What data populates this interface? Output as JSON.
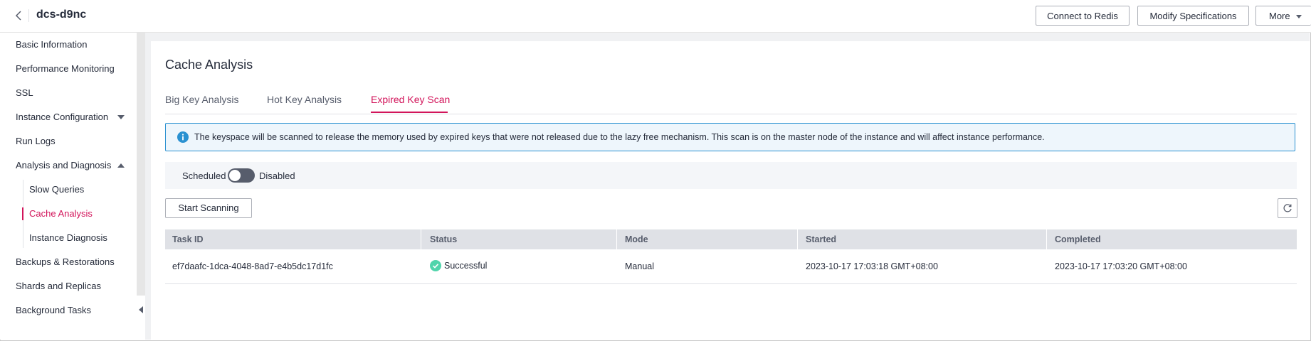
{
  "header": {
    "instance_name": "dcs-d9nc",
    "buttons": {
      "connect": "Connect to Redis",
      "modify": "Modify Specifications",
      "more": "More"
    }
  },
  "sidebar": {
    "items": [
      {
        "label": "Basic Information"
      },
      {
        "label": "Performance Monitoring"
      },
      {
        "label": "SSL"
      },
      {
        "label": "Instance Configuration"
      },
      {
        "label": "Run Logs"
      },
      {
        "label": "Analysis and Diagnosis"
      },
      {
        "label": "Slow Queries"
      },
      {
        "label": "Cache Analysis"
      },
      {
        "label": "Instance Diagnosis"
      },
      {
        "label": "Backups & Restorations"
      },
      {
        "label": "Shards and Replicas"
      },
      {
        "label": "Background Tasks"
      }
    ],
    "active_item": "Cache Analysis"
  },
  "main": {
    "title": "Cache Analysis",
    "tabs": [
      {
        "label": "Big Key Analysis"
      },
      {
        "label": "Hot Key Analysis"
      },
      {
        "label": "Expired Key Scan"
      }
    ],
    "active_tab": "Expired Key Scan",
    "notice": "The keyspace will be scanned to release the memory used by expired keys that were not released due to the lazy free mechanism. This scan is on the master node of the instance and will affect instance performance.",
    "schedule": {
      "label": "Scheduled",
      "state": "Disabled"
    },
    "start_button": "Start Scanning",
    "table": {
      "columns": [
        "Task ID",
        "Status",
        "Mode",
        "Started",
        "Completed"
      ],
      "rows": [
        {
          "task_id": "ef7daafc-1dca-4048-8ad7-e4b5dc17d1fc",
          "status": "Successful",
          "mode": "Manual",
          "started": "2023-10-17 17:03:18 GMT+08:00",
          "completed": "2023-10-17 17:03:20 GMT+08:00"
        }
      ]
    }
  },
  "colors": {
    "accent": "#d2145a",
    "info": "#2a91d1",
    "success": "#50d4ab"
  },
  "icons": [
    "back-arrow-icon",
    "chevron-down-icon",
    "chevron-up-icon",
    "info-icon",
    "refresh-icon",
    "success-check-icon",
    "collapse-sidebar-icon"
  ]
}
